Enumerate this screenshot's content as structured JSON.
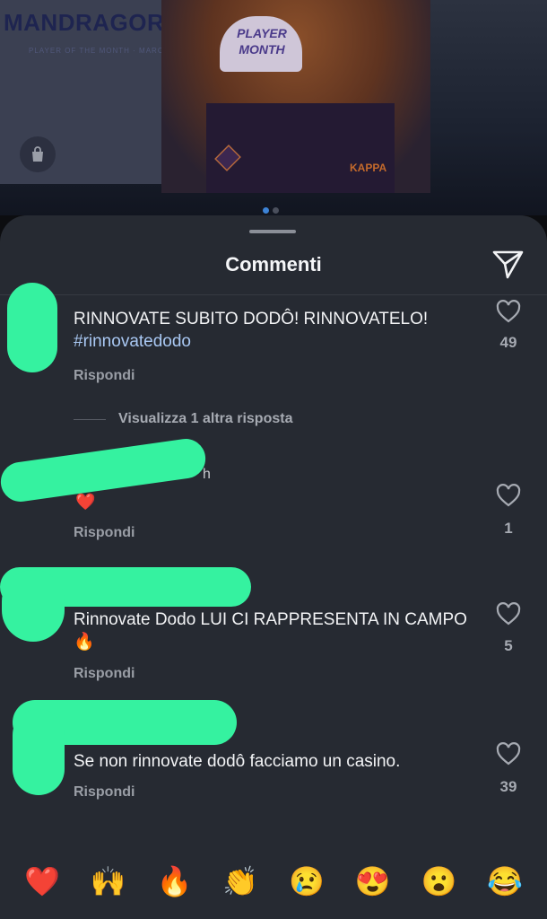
{
  "post_image": {
    "brand_text": "MANDRAGORA",
    "subline": "PLAYER OF THE MONTH · MARCH",
    "trophy_text": "PLAYER MONTH",
    "kappa_text": "KAPPA",
    "carousel_dots": 2,
    "active_dot": 1
  },
  "sheet": {
    "title": "Commenti"
  },
  "comments": [
    {
      "text": "RINNOVATE SUBITO DODÔ! RINNOVATELO!",
      "hashtag": "#rinnovatedodo",
      "reply": "Rispondi",
      "likes": "49",
      "more_replies": "Visualizza 1 altra risposta"
    },
    {
      "timestamp_fragment": "h",
      "text": "❤️",
      "reply": "Rispondi",
      "likes": "1"
    },
    {
      "text": "Rinnovate Dodo LUI CI RAPPRESENTA IN CAMPO🔥",
      "reply": "Rispondi",
      "likes": "5"
    },
    {
      "text": "Se non rinnovate dodô facciamo un casino.",
      "reply": "Rispondi",
      "likes": "39"
    }
  ],
  "reactions": [
    "❤️",
    "🙌",
    "🔥",
    "👏",
    "😢",
    "😍",
    "😮",
    "😂"
  ],
  "colors": {
    "sheet_bg": "#262a32",
    "hashtag": "#a9c8f3",
    "redaction": "#35f2a0",
    "active_dot": "#3d83d6"
  }
}
